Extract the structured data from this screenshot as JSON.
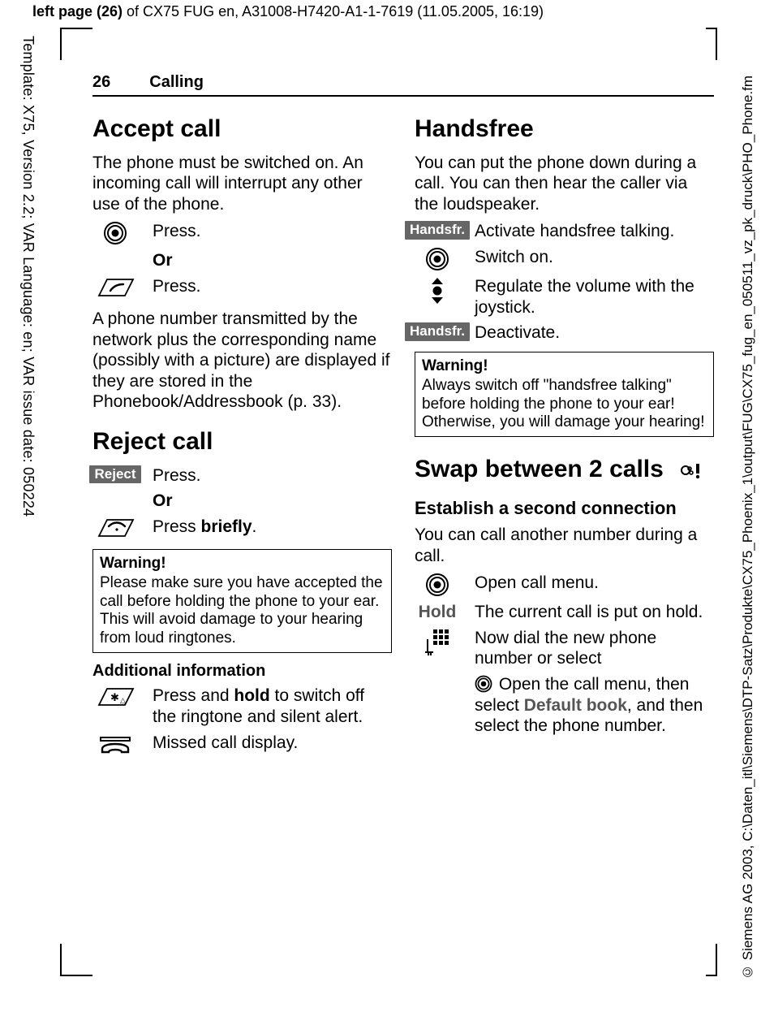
{
  "meta": {
    "top_header_bold": "left page (26)",
    "top_header_rest": " of CX75 FUG en, A31008-H7420-A1-1-7619 (11.05.2005, 16:19)",
    "side_left": "Template: X75, Version 2.2; VAR Language: en; VAR issue date: 050224",
    "side_right": "© Siemens AG 2003, C:\\Daten_itl\\Siemens\\DTP-Satz\\Produkte\\CX75_Phoenix_1\\output\\FUG\\CX75_fug_en_050511_vz_pk_druck\\PHO_Phone.fm"
  },
  "running": {
    "page_num": "26",
    "section": "Calling"
  },
  "left": {
    "accept": {
      "title": "Accept call",
      "intro": "The phone must be switched on. An incoming call will interrupt any other use of the phone.",
      "press1": "Press.",
      "or": "Or",
      "press2": "Press.",
      "para2": "A phone number transmitted by the network plus the corresponding name (possibly with a picture) are displayed if they are stored in the Phonebook/Addressbook (p. 33)."
    },
    "reject": {
      "title": "Reject call",
      "soft": "Reject",
      "press": "Press.",
      "or": "Or",
      "press_briefly_pre": "Press ",
      "press_briefly_bold": "briefly",
      "press_briefly_post": "."
    },
    "warn": {
      "title": "Warning!",
      "body": "Please make sure you have accepted the call before holding the phone to your ear. This will avoid damage to your hearing from loud ringtones."
    },
    "addl": {
      "title": "Additional information",
      "r1_pre": "Press and ",
      "r1_bold": "hold",
      "r1_post": " to switch off the ringtone and silent alert.",
      "r2": "Missed call display."
    }
  },
  "right": {
    "hf": {
      "title": "Handsfree",
      "intro": "You can put the phone down during a call. You can then hear the caller via the loudspeaker.",
      "soft": "Handsfr.",
      "r1": "Activate handsfree talking.",
      "r2": "Switch on.",
      "r3": "Regulate the volume with the joystick.",
      "r4": "Deactivate."
    },
    "warn": {
      "title": "Warning!",
      "body": "Always switch off \"handsfree talking\" before holding the phone to your ear! Otherwise, you will damage your hearing!"
    },
    "swap": {
      "title": "Swap between 2 calls",
      "sub": "Establish a second connection",
      "intro": "You can call another number during a call.",
      "r1": "Open call menu.",
      "hold_label": "Hold",
      "r2": "The current call is put on hold.",
      "r3": "Now dial the new phone number or select",
      "r4_pre": " Open the call menu, then select ",
      "r4_menu": "Default book",
      "r4_post": ", and then select the phone number."
    }
  }
}
